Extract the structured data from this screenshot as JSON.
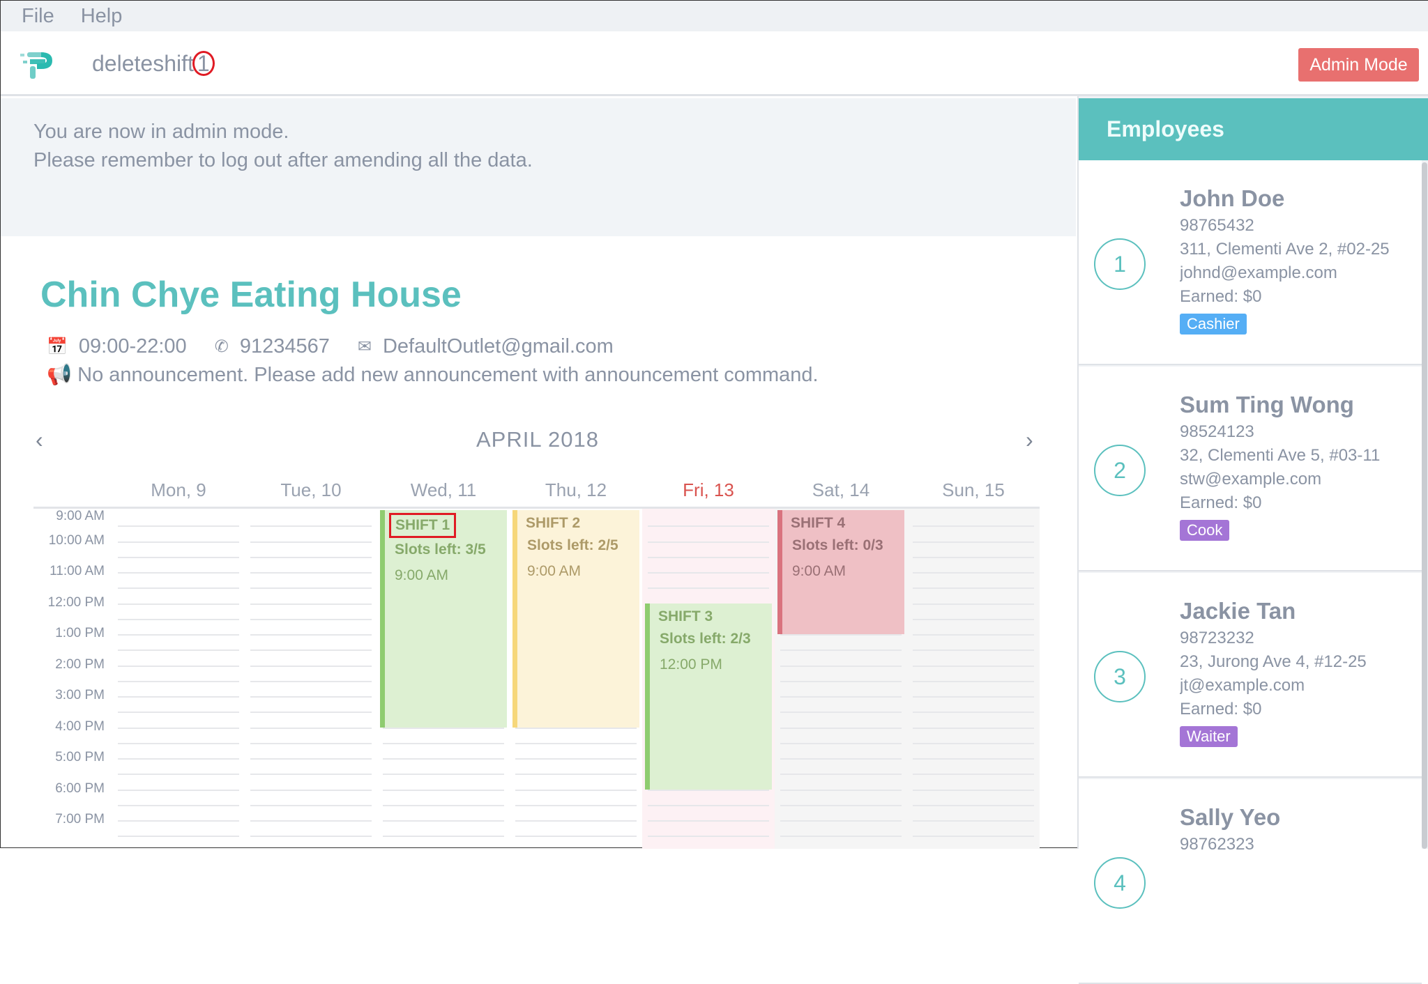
{
  "menu": [
    "File",
    "Help"
  ],
  "header": {
    "command_text": "deleteshift",
    "command_suffix": "1",
    "admin_button": "Admin Mode"
  },
  "notice": {
    "line1": "You are now in admin mode.",
    "line2": "Please remember to log out after amending all the data."
  },
  "outlet": {
    "name": "Chin Chye Eating House",
    "hours": "09:00-22:00",
    "phone": "91234567",
    "email": "DefaultOutlet@gmail.com",
    "announcement": "No announcement. Please add new announcement with announcement command.",
    "icons": {
      "hours": "calendar-icon",
      "phone": "phone-icon",
      "email": "envelope-icon",
      "announcement": "megaphone-icon"
    }
  },
  "calendar": {
    "month": "APRIL 2018",
    "days": [
      {
        "label": "Mon, 9"
      },
      {
        "label": "Tue, 10"
      },
      {
        "label": "Wed, 11"
      },
      {
        "label": "Thu, 12"
      },
      {
        "label": "Fri, 13",
        "today": true
      },
      {
        "label": "Sat, 14",
        "weekend": true
      },
      {
        "label": "Sun, 15",
        "weekend": true
      }
    ],
    "times": [
      "9:00 AM",
      "10:00 AM",
      "11:00 AM",
      "12:00 PM",
      "1:00 PM",
      "2:00 PM",
      "3:00 PM",
      "4:00 PM",
      "5:00 PM",
      "6:00 PM",
      "7:00 PM"
    ],
    "shifts": [
      {
        "title": "SHIFT 1",
        "slots": "Slots left: 3/5",
        "time": "9:00 AM",
        "day": 2,
        "start": 9,
        "end": 16,
        "theme": "green",
        "highlighted": true
      },
      {
        "title": "SHIFT 2",
        "slots": "Slots left: 2/5",
        "time": "9:00 AM",
        "day": 3,
        "start": 9,
        "end": 16,
        "theme": "yellow"
      },
      {
        "title": "SHIFT 3",
        "slots": "Slots left: 2/3",
        "time": "12:00 PM",
        "day": 4,
        "start": 12,
        "end": 18,
        "theme": "green"
      },
      {
        "title": "SHIFT 4",
        "slots": "Slots left: 0/3",
        "time": "9:00 AM",
        "day": 5,
        "start": 9,
        "end": 13,
        "theme": "red"
      }
    ],
    "colors": {
      "today_text": "#d9534f",
      "today_bg": "#fdf1f4",
      "weekend_bg": "#f5f5f5"
    }
  },
  "employees": {
    "title": "Employees",
    "list": [
      {
        "index": "1",
        "name": "John Doe",
        "phone": "98765432",
        "address": "311, Clementi Ave 2, #02-25",
        "email": "johnd@example.com",
        "earned": "Earned: $0",
        "role": "Cashier",
        "role_color": "#55aef5"
      },
      {
        "index": "2",
        "name": "Sum Ting Wong",
        "phone": "98524123",
        "address": "32, Clementi Ave 5, #03-11",
        "email": "stw@example.com",
        "earned": "Earned: $0",
        "role": "Cook",
        "role_color": "#a475d6"
      },
      {
        "index": "3",
        "name": "Jackie Tan",
        "phone": "98723232",
        "address": "23, Jurong Ave 4, #12-25",
        "email": "jt@example.com",
        "earned": "Earned: $0",
        "role": "Waiter",
        "role_color": "#a475d6"
      },
      {
        "index": "4",
        "name": "Sally Yeo",
        "phone": "98762323"
      }
    ]
  },
  "colors": {
    "accent": "#5bc0be",
    "admin": "#e8706f"
  }
}
